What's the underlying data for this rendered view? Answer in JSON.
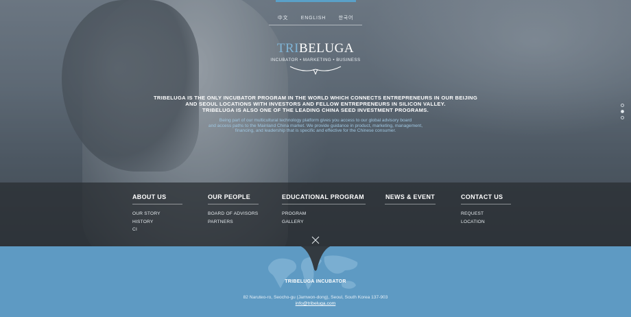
{
  "languages": [
    "中文",
    "ENGLISH",
    "한국어"
  ],
  "logo": {
    "part1": "TRI",
    "part2": "BELUGA",
    "tagline": "INCUBATOR • MARKETING • BUSINESS"
  },
  "headline": {
    "line1": "TRIBELUGA IS THE ONLY INCUBATOR PROGRAM IN THE WORLD WHICH CONNECTS ENTREPRENEURS IN OUR BEIJING",
    "line2": "AND SEOUL LOCATIONS WITH INVESTORS AND FELLOW ENTREPRENEURS IN SILICON VALLEY.",
    "line3": "TRIBELUGA IS ALSO ONE OF THE LEADING CHINA SEED INVESTMENT PROGRAMS."
  },
  "subtext": {
    "line1": "Being part of our multicultural technology platform gives you access to our global advisory board",
    "line2": "and access paths to the Mainland China market. We provide guidance in product, marketing, management,",
    "line3": "financing, and leadership that is specific and effective for the Chinese consumer."
  },
  "slider": {
    "count": 3,
    "active_index": 1
  },
  "nav": {
    "about": {
      "title": "ABOUT US",
      "items": [
        "OUR STORY",
        "HISTORY",
        "CI"
      ]
    },
    "people": {
      "title": "OUR PEOPLE",
      "items": [
        "BOARD OF ADVISORS",
        "PARTNERS"
      ]
    },
    "education": {
      "title": "EDUCATIONAL PROGRAM",
      "items": [
        "PROGRAM",
        "GALLERY"
      ]
    },
    "news": {
      "title": "NEWS & EVENT",
      "items": []
    },
    "contact": {
      "title": "CONTACT US",
      "items": [
        "REQUEST",
        "LOCATION"
      ]
    }
  },
  "footer": {
    "name": "TRIBELUGA INCUBATOR",
    "address": "82 Naruteo-ro, Seocho-gu (Jamwon-dong), Seoul, South Korea 137-903",
    "email": "info@tribeluga.com"
  },
  "colors": {
    "accent": "#5aa0c8",
    "footer_bg": "#5e9ac3",
    "logo_accent": "#7fb4d6"
  }
}
